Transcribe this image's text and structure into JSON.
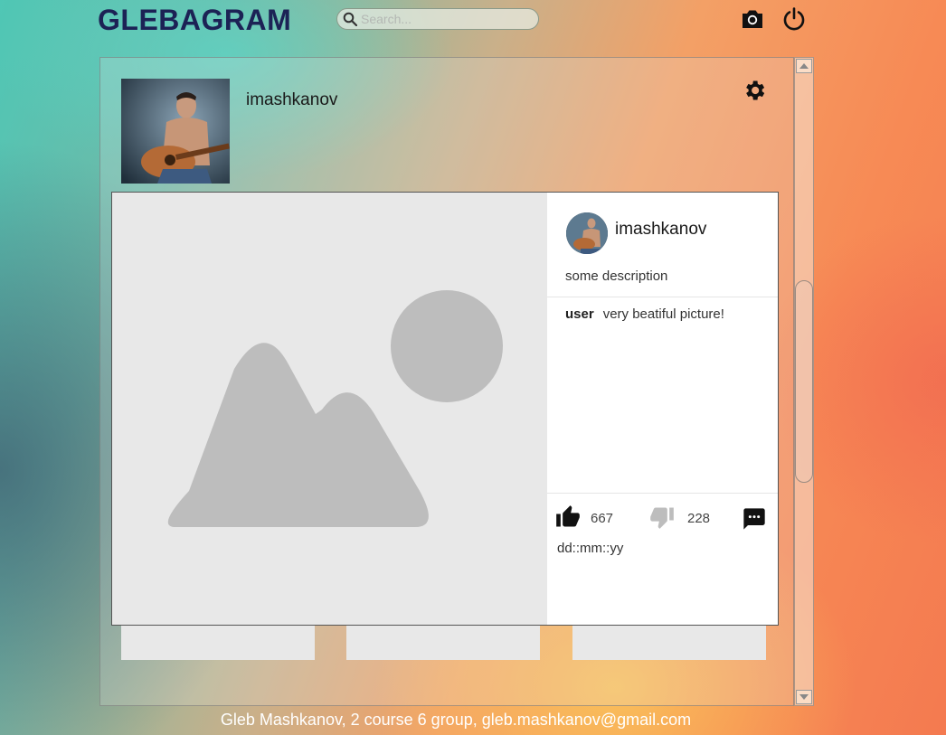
{
  "header": {
    "logo": "GLEBAGRAM",
    "search_placeholder": "Search...",
    "icons": [
      "camera-icon",
      "power-icon"
    ]
  },
  "profile": {
    "username": "imashkanov",
    "settings_icon": "gear-icon"
  },
  "post": {
    "username": "imashkanov",
    "description": "some description",
    "comments": [
      {
        "user": "user",
        "text": "very beatiful picture!"
      }
    ],
    "likes": "667",
    "dislikes": "228",
    "date": "dd::mm::yy",
    "icons": [
      "thumbs-up-icon",
      "thumbs-down-icon",
      "comment-icon",
      "image-placeholder-icon"
    ]
  },
  "footer": {
    "text": "Gleb Mashkanov, 2 course 6 group, gleb.mashkanov@gmail.com"
  },
  "colors": {
    "logo": "#1c2255",
    "placeholder_image": "#bdbdbd",
    "modal_bg": "#ffffff"
  }
}
